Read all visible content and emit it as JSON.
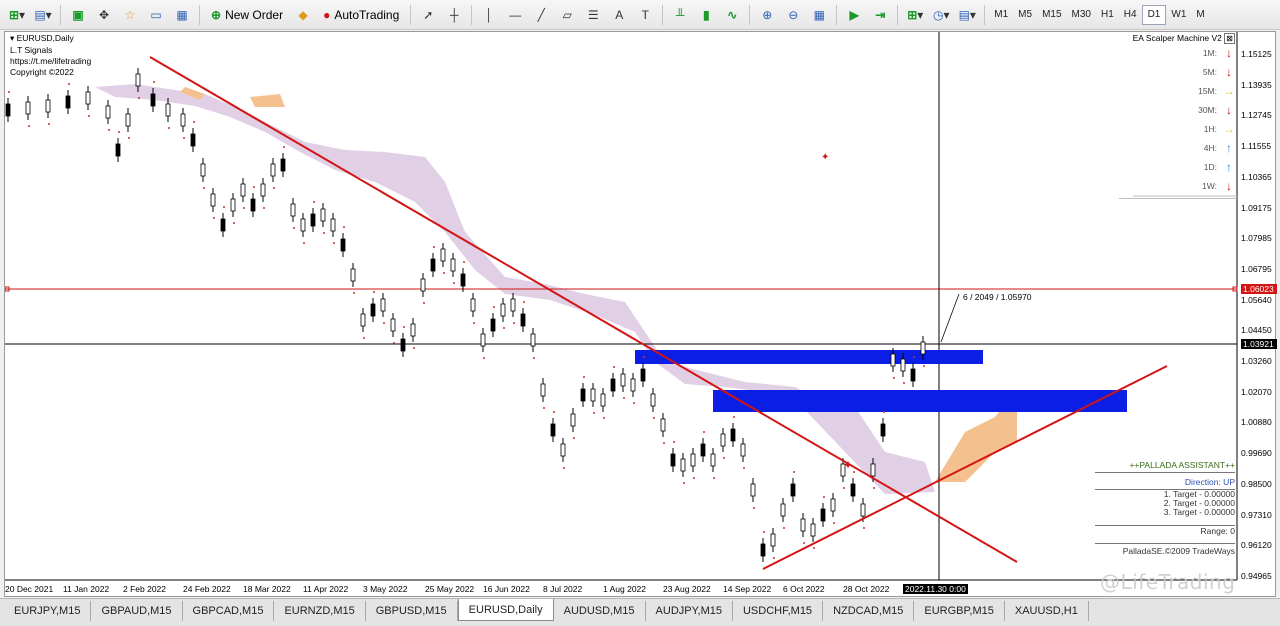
{
  "toolbar": {
    "new_order_label": "New Order",
    "autotrading_label": "AutoTrading",
    "timeframes": [
      "M1",
      "M5",
      "M15",
      "M30",
      "H1",
      "H4",
      "D1",
      "W1",
      "M"
    ],
    "active_timeframe": "D1"
  },
  "chart": {
    "symbol_label": "EURUSD,Daily",
    "info_lines": [
      "L.T Signals",
      "https://t.me/lifetrading",
      "Copyright ©2022"
    ],
    "price_labels": [
      "1.15125",
      "1.13935",
      "1.12745",
      "1.11555",
      "1.10365",
      "1.09175",
      "1.07985",
      "1.06795",
      "1.05640",
      "1.04450",
      "1.03260",
      "1.02070",
      "1.00880",
      "0.99690",
      "0.98500",
      "0.97310",
      "0.96120",
      "0.94965"
    ],
    "red_level_label": "1.06023",
    "current_price_label": "1.03921",
    "date_labels": [
      "20 Dec 2021",
      "11 Jan 2022",
      "2 Feb 2022",
      "24 Feb 2022",
      "18 Mar 2022",
      "11 Apr 2022",
      "3 May 2022",
      "25 May 2022",
      "16 Jun 2022",
      "8 Jul 2022",
      "1 Aug 2022",
      "23 Aug 2022",
      "14 Sep 2022",
      "6 Oct 2022",
      "28 Oct 2022"
    ],
    "cursor_date": "2022.11.30 0:00",
    "crosshair_readout": "6 / 2049 / 1.05970",
    "colors": {
      "bull": "#000000",
      "bear": "#000000",
      "kumo": "#dcc8e0",
      "kumo_orange": "#f4c08e",
      "trendline": "#d21414",
      "zone_blue": "#0a1ee6",
      "red_level": "#d21414"
    }
  },
  "ea_panel": {
    "title": "EA Scalper Machine V2",
    "rows": [
      {
        "tf": "1M:",
        "dir": "down"
      },
      {
        "tf": "5M:",
        "dir": "down"
      },
      {
        "tf": "15M:",
        "dir": "right"
      },
      {
        "tf": "30M:",
        "dir": "down"
      },
      {
        "tf": "1H:",
        "dir": "right"
      },
      {
        "tf": "4H:",
        "dir": "up"
      },
      {
        "tf": "1D:",
        "dir": "up"
      },
      {
        "tf": "1W:",
        "dir": "down"
      }
    ]
  },
  "palladia": {
    "title": "++PALLADA ASSISTANT++",
    "direction": "Direction: UP",
    "target1": "1. Target - 0.00000",
    "target2": "2. Target - 0.00000",
    "target3": "3. Target - 0.00000",
    "range": "Range: 0",
    "copyright": "PalladaSE.©2009 TradeWays"
  },
  "tabs": [
    "EURJPY,M15",
    "GBPAUD,M15",
    "GBPCAD,M15",
    "EURNZD,M15",
    "GBPUSD,M15",
    "EURUSD,Daily",
    "AUDUSD,M15",
    "AUDJPY,M15",
    "USDCHF,M15",
    "NZDCAD,M15",
    "EURGBP,M15",
    "XAUUSD,H1"
  ],
  "active_tab": "EURUSD,Daily",
  "watermark": "@LifeTrading"
}
